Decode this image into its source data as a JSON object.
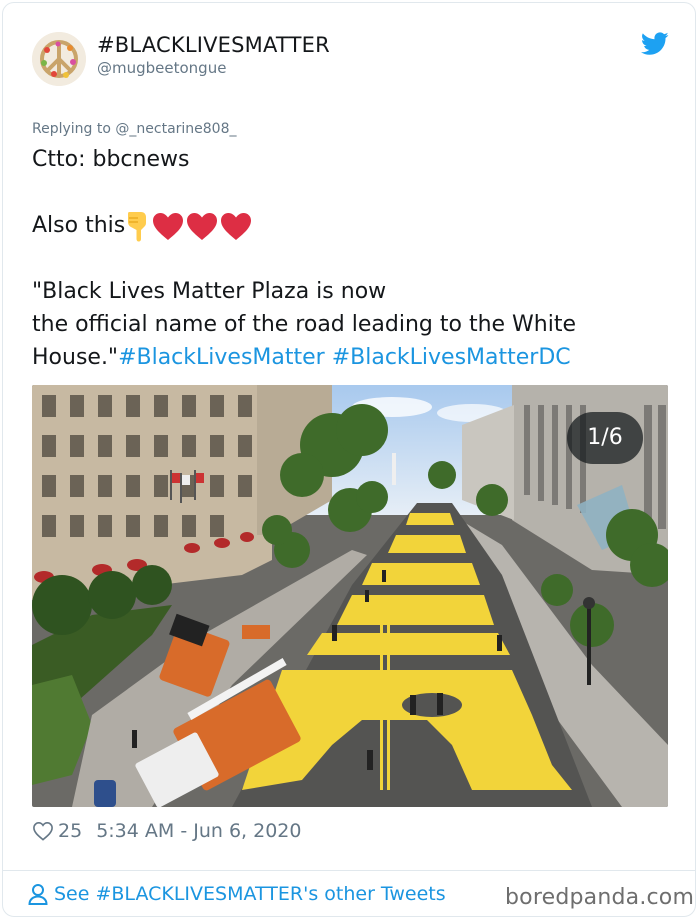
{
  "author": {
    "display_name": "#BLACKLIVESMATTER",
    "handle": "@mugbeetongue"
  },
  "reply": {
    "prefix": "Replying to ",
    "user": "@_nectarine808_"
  },
  "tweet": {
    "line1": "Ctto: bbcnews",
    "line2": "Also this",
    "quote_line1": "\"Black Lives Matter Plaza is now",
    "quote_line2": "the official name of the road leading to the White",
    "quote_line3": "House.\"",
    "hashtag1": "#BlackLivesMatter",
    "hashtag2": "#BlackLivesMatterDC"
  },
  "media": {
    "counter": "1/6"
  },
  "stats": {
    "likes": "25",
    "timestamp": "5:34 AM - Jun 6, 2020"
  },
  "footer": {
    "link": "See #BLACKLIVESMATTER's other Tweets",
    "watermark": "boredpanda.com"
  },
  "colors": {
    "link": "#1b95e0",
    "muted": "#657786",
    "twitter_blue": "#1da1f2"
  }
}
